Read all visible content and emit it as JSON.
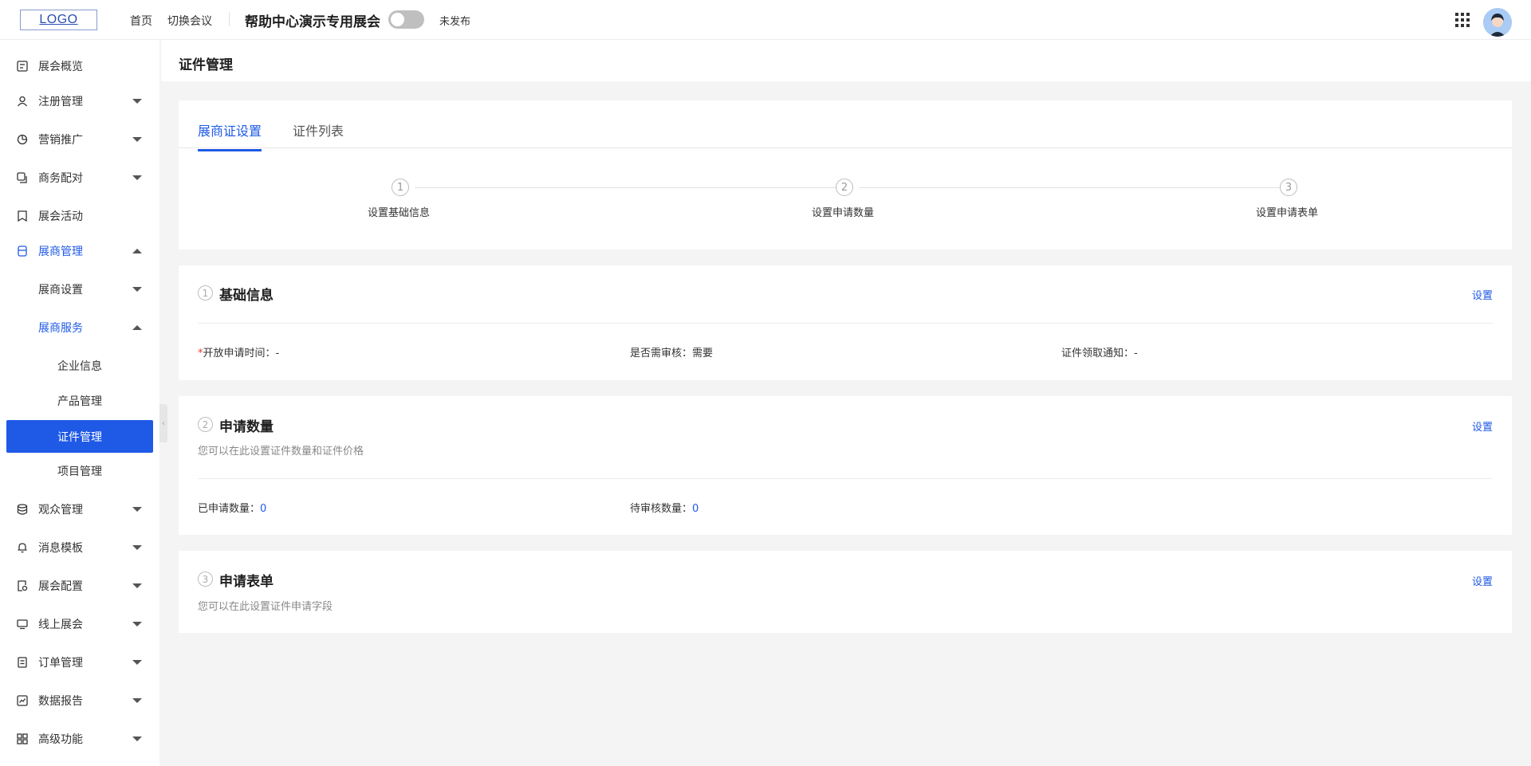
{
  "header": {
    "logo_text": "LOGO",
    "nav_home": "首页",
    "nav_switch": "切换会议",
    "event_title": "帮助中心演示专用展会",
    "publish_status": "未发布"
  },
  "sidebar": {
    "items": [
      {
        "label": "展会概览",
        "icon": "dashboard-icon"
      },
      {
        "label": "注册管理",
        "icon": "user-icon"
      },
      {
        "label": "营销推广",
        "icon": "pie-chart-icon"
      },
      {
        "label": "商务配对",
        "icon": "copy-icon"
      },
      {
        "label": "展会活动",
        "icon": "bookmark-icon"
      },
      {
        "label": "展商管理",
        "icon": "store-icon"
      },
      {
        "label": "展商设置"
      },
      {
        "label": "展商服务"
      },
      {
        "label": "企业信息"
      },
      {
        "label": "产品管理"
      },
      {
        "label": "证件管理"
      },
      {
        "label": "项目管理"
      },
      {
        "label": "观众管理",
        "icon": "database-icon"
      },
      {
        "label": "消息模板",
        "icon": "bell-icon"
      },
      {
        "label": "展会配置",
        "icon": "settings-doc-icon"
      },
      {
        "label": "线上展会",
        "icon": "monitor-icon"
      },
      {
        "label": "订单管理",
        "icon": "order-icon"
      },
      {
        "label": "数据报告",
        "icon": "line-chart-icon"
      },
      {
        "label": "高级功能",
        "icon": "grid-icon"
      }
    ]
  },
  "page": {
    "title": "证件管理"
  },
  "tabs": {
    "active": "展商证设置",
    "other": "证件列表"
  },
  "steps": [
    {
      "num": "1",
      "label": "设置基础信息"
    },
    {
      "num": "2",
      "label": "设置申请数量"
    },
    {
      "num": "3",
      "label": "设置申请表单"
    }
  ],
  "sections": {
    "basic": {
      "num": "1",
      "title": "基础信息",
      "link": "设置",
      "open_time_label": "开放申请时间：",
      "open_time_value": "-",
      "review_label": "是否需审核：",
      "review_value": "需要",
      "notify_label": "证件领取通知：",
      "notify_value": "-"
    },
    "quantity": {
      "num": "2",
      "title": "申请数量",
      "link": "设置",
      "desc": "您可以在此设置证件数量和证件价格",
      "applied_label": "已申请数量：",
      "applied_value": "0",
      "pending_label": "待审核数量：",
      "pending_value": "0"
    },
    "form": {
      "num": "3",
      "title": "申请表单",
      "link": "设置",
      "desc": "您可以在此设置证件申请字段"
    }
  },
  "colors": {
    "accent": "#1f5ae6",
    "required": "#e53935"
  }
}
